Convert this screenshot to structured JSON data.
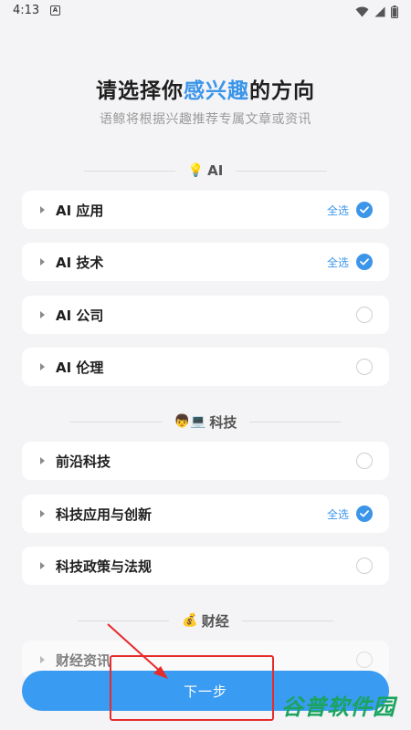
{
  "status_bar": {
    "time": "4:13",
    "app_icon_letter": "A",
    "icons": [
      "wifi-icon",
      "signal-icon",
      "battery-icon"
    ]
  },
  "header": {
    "title_before": "请选择你",
    "title_highlight": "感兴趣",
    "title_after": "的方向",
    "subtitle": "语鲸将根据兴趣推荐专属文章或资讯"
  },
  "colors": {
    "accent": "#3b95e9",
    "button": "#3a9bf2",
    "annotation": "#e62b2b",
    "watermark": "#1aa45f"
  },
  "sections": [
    {
      "emoji": "💡",
      "title": "AI",
      "items": [
        {
          "label": "AI 应用",
          "select_all": "全选",
          "checked": true
        },
        {
          "label": "AI 技术",
          "select_all": "全选",
          "checked": true
        },
        {
          "label": "AI 公司",
          "select_all": "",
          "checked": false
        },
        {
          "label": "AI 伦理",
          "select_all": "",
          "checked": false
        }
      ]
    },
    {
      "emoji": "👦💻",
      "title": "科技",
      "items": [
        {
          "label": "前沿科技",
          "select_all": "",
          "checked": false
        },
        {
          "label": "科技应用与创新",
          "select_all": "全选",
          "checked": true
        },
        {
          "label": "科技政策与法规",
          "select_all": "",
          "checked": false
        }
      ]
    },
    {
      "emoji": "💰",
      "title": "财经",
      "items": [
        {
          "label": "财经资讯",
          "select_all": "",
          "checked": false
        }
      ]
    }
  ],
  "next_button": {
    "label": "下一步"
  },
  "watermark": {
    "text": "谷普软件园"
  }
}
